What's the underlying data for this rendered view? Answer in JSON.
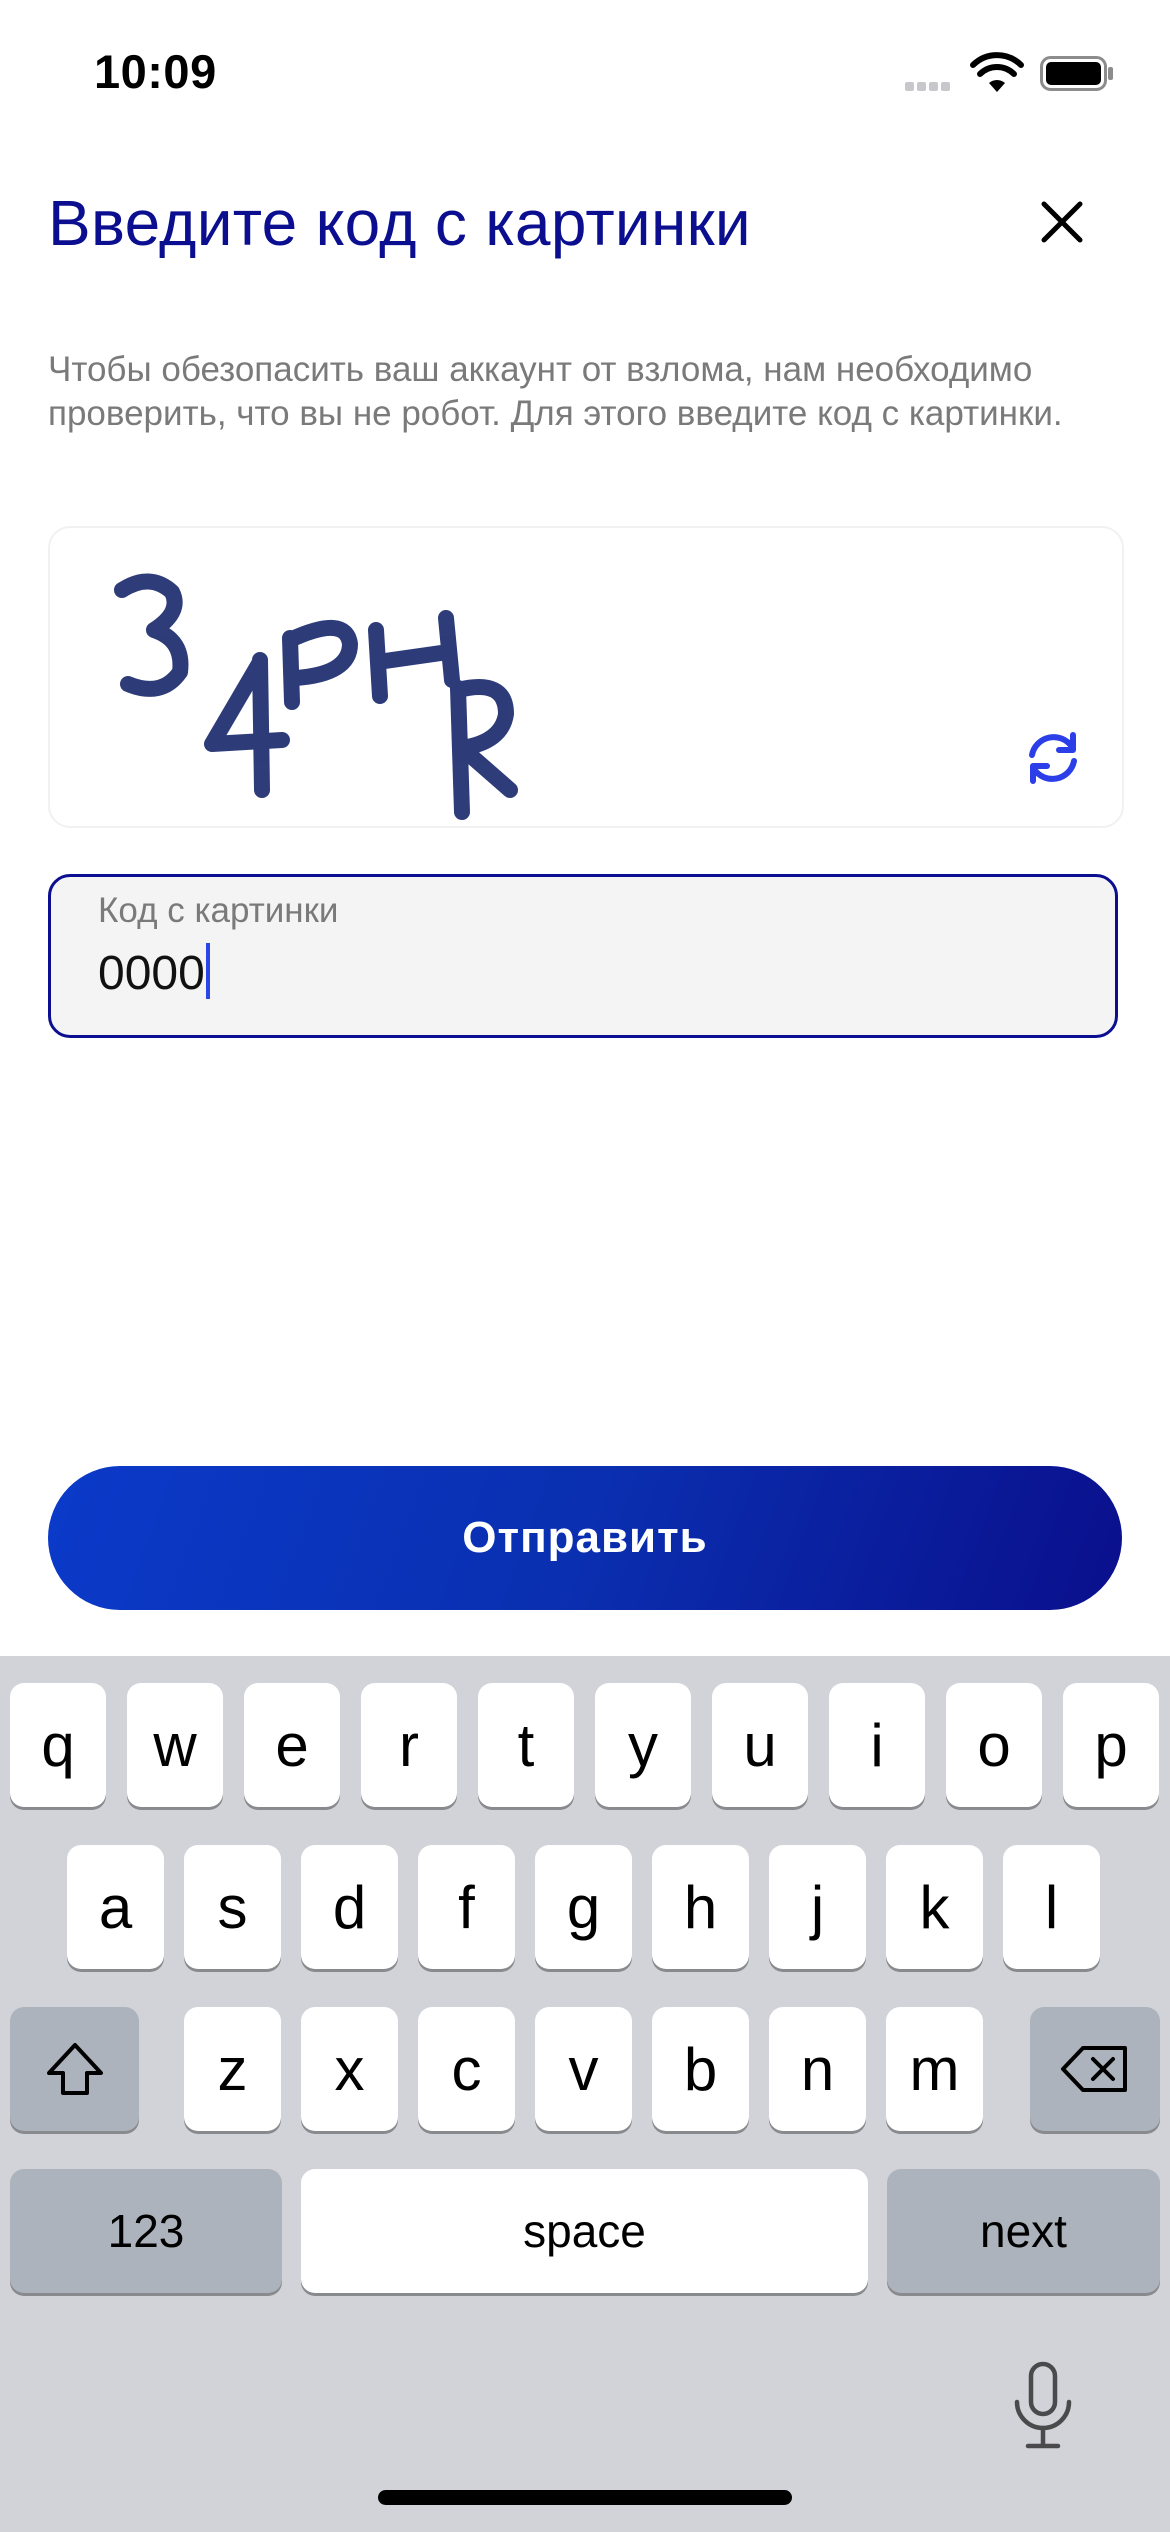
{
  "status_bar": {
    "time": "10:09",
    "icons": [
      "signal-icon",
      "wifi-icon",
      "battery-icon"
    ]
  },
  "header": {
    "title": "Введите код с картинки",
    "close_icon": "close-icon"
  },
  "description": "Чтобы обезопасить ваш аккаунт от взлома, нам необходимо проверить, что вы не робот. Для этого введите код с картинки.",
  "captcha": {
    "text": "34PHR",
    "refresh_icon": "refresh-icon"
  },
  "code_field": {
    "label": "Код с картинки",
    "value": "0000"
  },
  "submit_label": "Отправить",
  "keyboard": {
    "row1": [
      "q",
      "w",
      "e",
      "r",
      "t",
      "y",
      "u",
      "i",
      "o",
      "p"
    ],
    "row2": [
      "a",
      "s",
      "d",
      "f",
      "g",
      "h",
      "j",
      "k",
      "l"
    ],
    "row3": [
      "z",
      "x",
      "c",
      "v",
      "b",
      "n",
      "m"
    ],
    "numbers_label": "123",
    "space_label": "space",
    "next_label": "next"
  },
  "colors": {
    "accent": "#0b0f8f",
    "button_start": "#0b3ac9",
    "button_end": "#0a0f8c",
    "keyboard_bg": "#d1d3d9"
  }
}
